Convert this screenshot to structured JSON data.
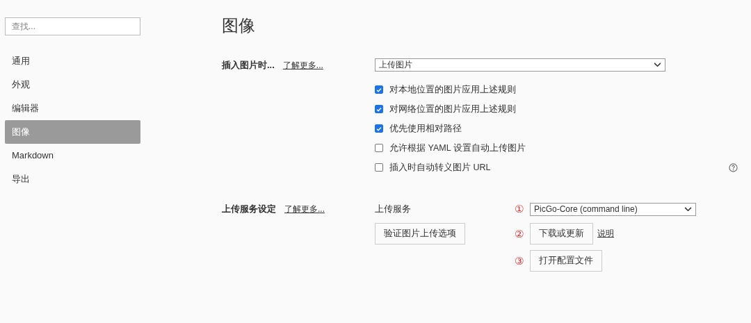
{
  "search": {
    "placeholder": "查找..."
  },
  "sidebar": {
    "items": [
      {
        "label": "通用",
        "selected": false
      },
      {
        "label": "外观",
        "selected": false
      },
      {
        "label": "编辑器",
        "selected": false
      },
      {
        "label": "图像",
        "selected": true
      },
      {
        "label": "Markdown",
        "selected": false
      },
      {
        "label": "导出",
        "selected": false
      }
    ]
  },
  "page_title": "图像",
  "insert_section": {
    "label": "插入图片时...",
    "link": "了解更多...",
    "select_value": "上传图片",
    "options": [
      {
        "label": "对本地位置的图片应用上述规则",
        "checked": true
      },
      {
        "label": "对网络位置的图片应用上述规则",
        "checked": true
      },
      {
        "label": "优先使用相对路径",
        "checked": true
      },
      {
        "label": "允许根据 YAML 设置自动上传图片",
        "checked": false
      },
      {
        "label": "插入时自动转义图片 URL",
        "checked": false
      }
    ]
  },
  "upload_section": {
    "label": "上传服务设定",
    "link": "了解更多...",
    "service_label": "上传服务",
    "verify_button": "验证图片上传选项",
    "steps": [
      {
        "marker": "①",
        "kind": "select",
        "value": "PicGo-Core (command line)"
      },
      {
        "marker": "②",
        "kind": "button",
        "label": "下载或更新",
        "link": "说明"
      },
      {
        "marker": "③",
        "kind": "button",
        "label": "打开配置文件"
      }
    ]
  }
}
